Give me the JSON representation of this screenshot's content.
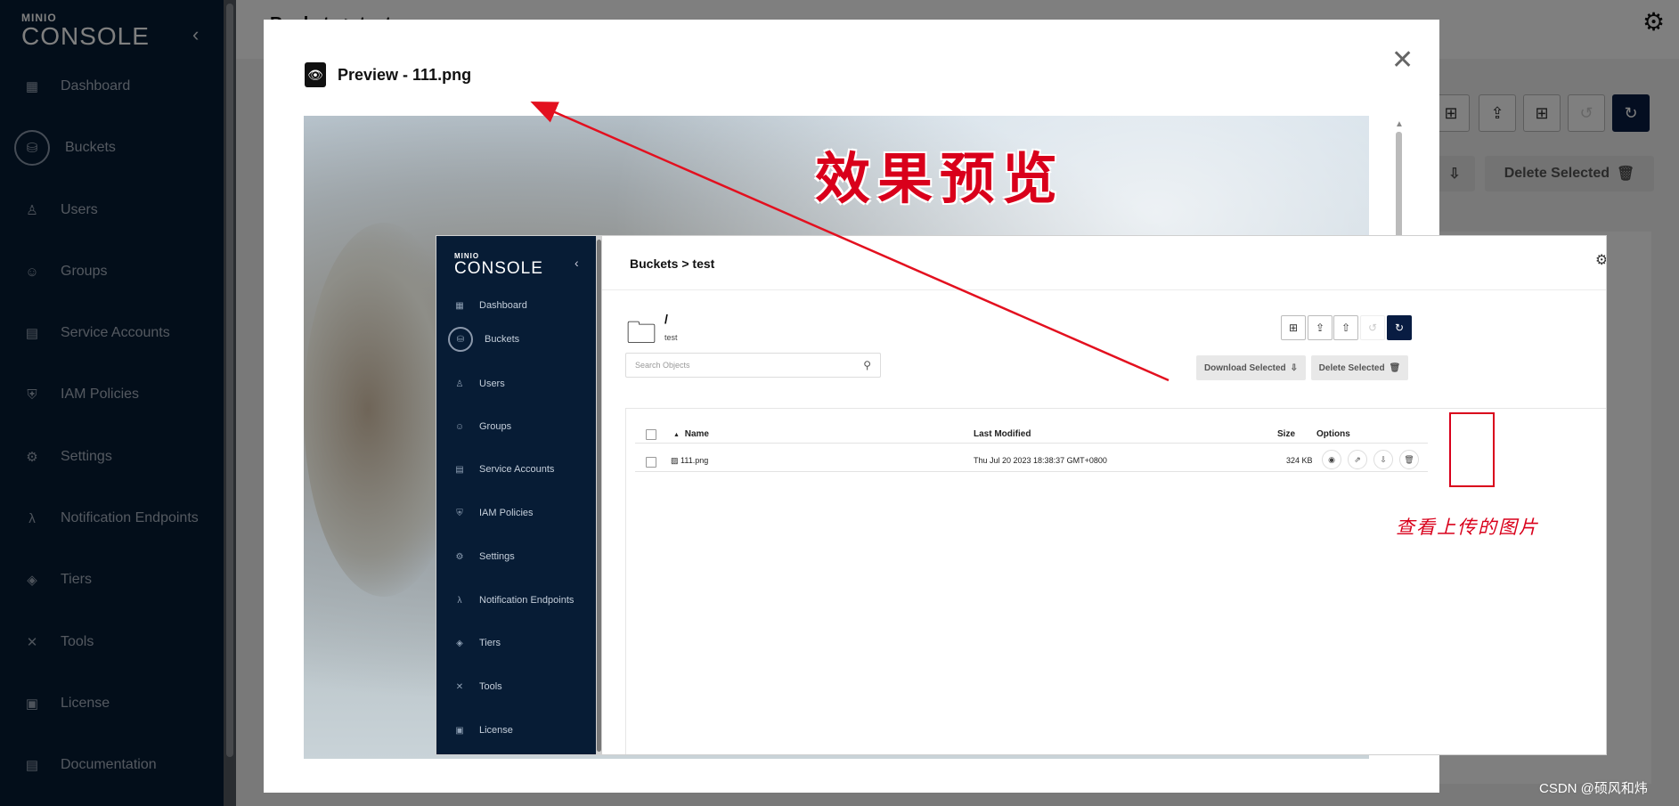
{
  "app": {
    "brand_mini": "MINIO",
    "brand_name": "CONSOLE",
    "page_title": "Buckets > test",
    "collapse_glyph": "‹",
    "gear_glyph": "⚙"
  },
  "sidebar": {
    "items": [
      {
        "label": "Dashboard",
        "icon": "dashboard-icon",
        "glyph": "▦"
      },
      {
        "label": "Buckets",
        "icon": "bucket-icon",
        "glyph": "⛁",
        "active": true
      },
      {
        "label": "Users",
        "icon": "user-icon",
        "glyph": "♙"
      },
      {
        "label": "Groups",
        "icon": "groups-icon",
        "glyph": "☺"
      },
      {
        "label": "Service Accounts",
        "icon": "service-accounts-icon",
        "glyph": "▤"
      },
      {
        "label": "IAM Policies",
        "icon": "shield-icon",
        "glyph": "⛨"
      },
      {
        "label": "Settings",
        "icon": "gear-icon",
        "glyph": "⚙"
      },
      {
        "label": "Notification Endpoints",
        "icon": "lambda-icon",
        "glyph": "λ"
      },
      {
        "label": "Tiers",
        "icon": "layers-icon",
        "glyph": "◈"
      },
      {
        "label": "Tools",
        "icon": "tools-icon",
        "glyph": "✕"
      },
      {
        "label": "License",
        "icon": "license-icon",
        "glyph": "▣"
      },
      {
        "label": "Documentation",
        "icon": "document-icon",
        "glyph": "▤"
      }
    ]
  },
  "background_toolbar": {
    "delete_selected_label": "Delete Selected",
    "refresh_glyph": "↻",
    "upload_glyph": "⇪",
    "new_folder_glyph": "⊞",
    "download_glyph": "⇩",
    "rewind_glyph": "↺",
    "trash_glyph": "🗑"
  },
  "modal": {
    "title": "Preview - 111.png",
    "title_icon": "eye-icon",
    "title_glyph": "👁",
    "close_glyph": "✕",
    "scroll_glyph": "▲",
    "annotation_title": "效果预览",
    "annotation_note": "查看上传的图片"
  },
  "embedded": {
    "brand_mini": "MINIO",
    "brand_name": "CONSOLE",
    "collapse_glyph": "‹",
    "gear_glyph": "⚙",
    "title": "Buckets > test",
    "path": "/",
    "bucket_name": "test",
    "folder_glyph": "🗀",
    "search_placeholder": "Search Objects",
    "search_glyph": "⚲",
    "download_selected_label": "Download Selected",
    "delete_selected_label": "Delete Selected",
    "download_glyph": "⇩",
    "trash_glyph": "🗑",
    "new_folder_glyph": "⊞",
    "upload_glyph": "⇪",
    "upload_folder_glyph": "⇧",
    "rewind_glyph": "↺",
    "refresh_glyph": "↻",
    "nav": [
      "Dashboard",
      "Buckets",
      "Users",
      "Groups",
      "Service Accounts",
      "IAM Policies",
      "Settings",
      "Notification Endpoints",
      "Tiers",
      "Tools",
      "License"
    ],
    "table": {
      "headers": {
        "name": "Name",
        "last_modified": "Last Modified",
        "size": "Size",
        "options": "Options"
      },
      "sort_glyph": "▲",
      "rows": [
        {
          "file_glyph": "▨",
          "name": "111.png",
          "last_modified": "Thu Jul 20 2023 18:38:37 GMT+0800",
          "size": "324 KB"
        }
      ],
      "option_glyphs": {
        "preview": "◉",
        "share": "⇗",
        "download": "⇩",
        "delete": "🗑"
      }
    }
  },
  "watermark": "CSDN @硕风和炜",
  "colors": {
    "sidebar": "#071c35",
    "accent_dark": "#081c42",
    "annotation_red": "#d9001b"
  }
}
